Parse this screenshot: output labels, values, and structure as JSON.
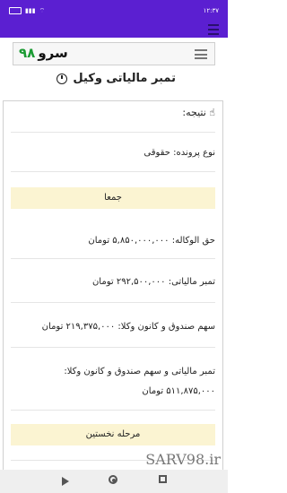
{
  "status": {
    "time": "۱۲:۳۷"
  },
  "header": {
    "logo_name": "سرو",
    "logo_number": "۹۸"
  },
  "page": {
    "title": "تمبر مالیاتی وکیل"
  },
  "result": {
    "heading": "نتیجه:",
    "case_type": "نوع پرونده: حقوقی",
    "total_band": "جمعا",
    "fee": "حق الوکاله: ۵,۸۵۰,۰۰۰,۰۰۰ تومان",
    "stamp": "تمبر مالیاتی: ۲۹۲,۵۰۰,۰۰۰ تومان",
    "fund_share": "سهم صندوق و کانون وکلا: ۲۱۹,۳۷۵,۰۰۰ تومان",
    "stamp_and_fund_label": "تمبر مالیاتی و سهم صندوق و کانون وکلا:",
    "stamp_and_fund_value": "۵۱۱,۸۷۵,۰۰۰ تومان",
    "stage_band": "مرحله نخستین"
  },
  "watermark": "SARV98.ir",
  "icons": {
    "clock": "clock-icon",
    "result": "thumbs-up-icon",
    "menu": "hamburger-menu-icon",
    "nav_back": "play-back-icon",
    "nav_home": "home-circle-icon",
    "nav_recent": "recent-square-icon"
  }
}
